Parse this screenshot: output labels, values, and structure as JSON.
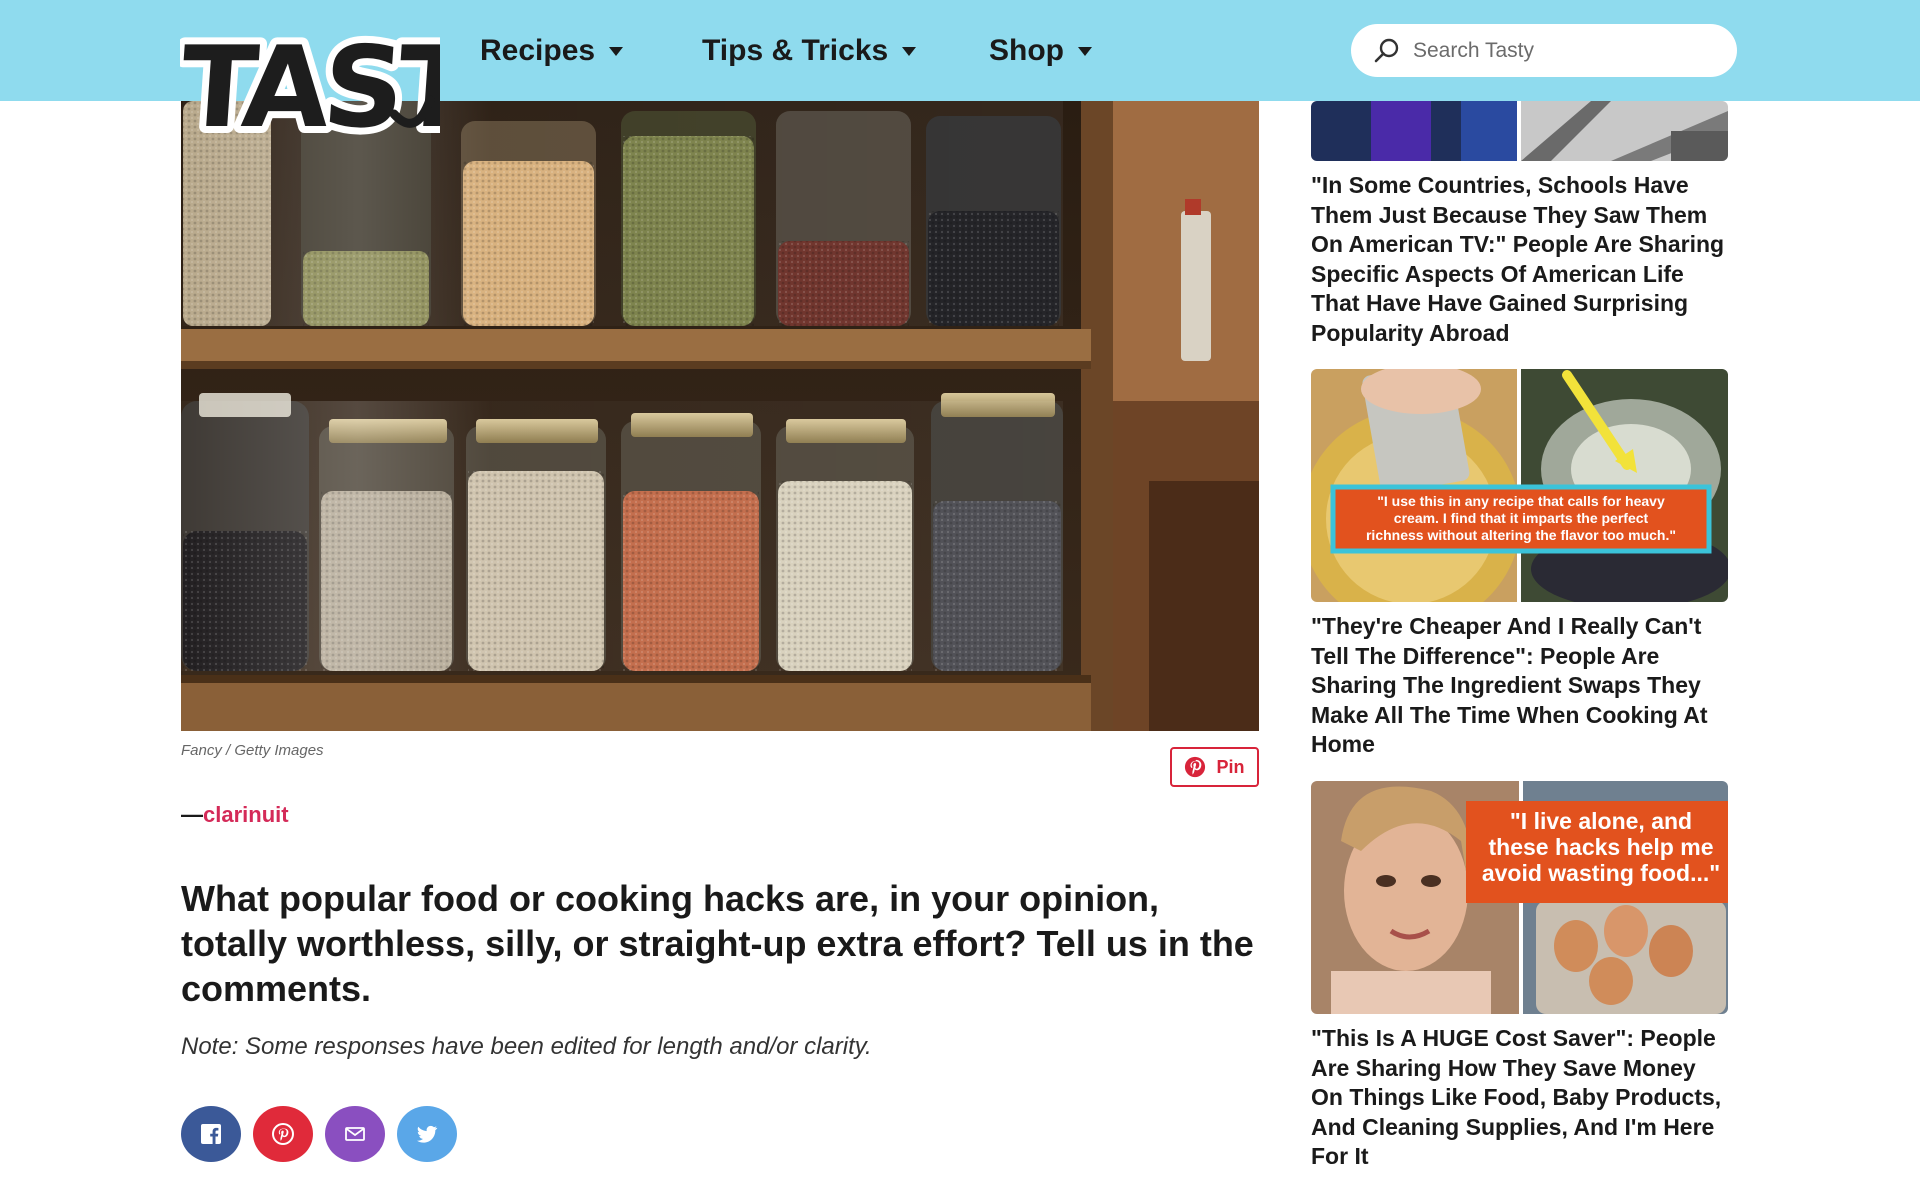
{
  "header": {
    "logo_text": "TASTY",
    "nav": [
      {
        "label": "Recipes"
      },
      {
        "label": "Tips & Tricks"
      },
      {
        "label": "Shop"
      }
    ],
    "search_placeholder": "Search Tasty"
  },
  "article": {
    "image_credit": "Fancy / Getty Images",
    "pin_label": "Pin",
    "byline_prefix": "—",
    "byline_user": "clarinuit",
    "question": "What popular food or cooking hacks are, in your opinion, totally worthless, silly, or straight-up extra effort? Tell us in the comments.",
    "note": "Note: Some responses have been edited for length and/or clarity.",
    "share_icons": [
      "facebook-icon",
      "pinterest-icon",
      "email-icon",
      "twitter-icon"
    ]
  },
  "sidebar": {
    "cards": [
      {
        "title": "\"In Some Countries, Schools Have Them Just Because They Saw Them On American TV:\" People Are Sharing Specific Aspects Of American Life That Have Have Gained Surprising Popularity Abroad"
      },
      {
        "image_caption": "\"I use this in any recipe that calls for heavy cream. I find that it imparts the perfect richness without altering the flavor too much.\"",
        "title": "\"They're Cheaper And I Really Can't Tell The Difference\": People Are Sharing The Ingredient Swaps They Make All The Time When Cooking At Home"
      },
      {
        "image_caption": "\"I live alone, and these hacks help me avoid wasting food...\"",
        "title": "\"This Is A HUGE Cost Saver\": People Are Sharing How They Save Money On Things Like Food, Baby Products, And Cleaning Supplies, And I'm Here For It"
      }
    ]
  },
  "colors": {
    "header_bg": "#8fdbee",
    "byline_link": "#d42a58",
    "pin_red": "#d8243a",
    "facebook": "#3b5998",
    "pinterest": "#e02a3a",
    "email": "#8a4fc0",
    "twitter": "#5aa7e8",
    "callout_orange": "#e2521e",
    "callout_border": "#3bc3d9"
  }
}
